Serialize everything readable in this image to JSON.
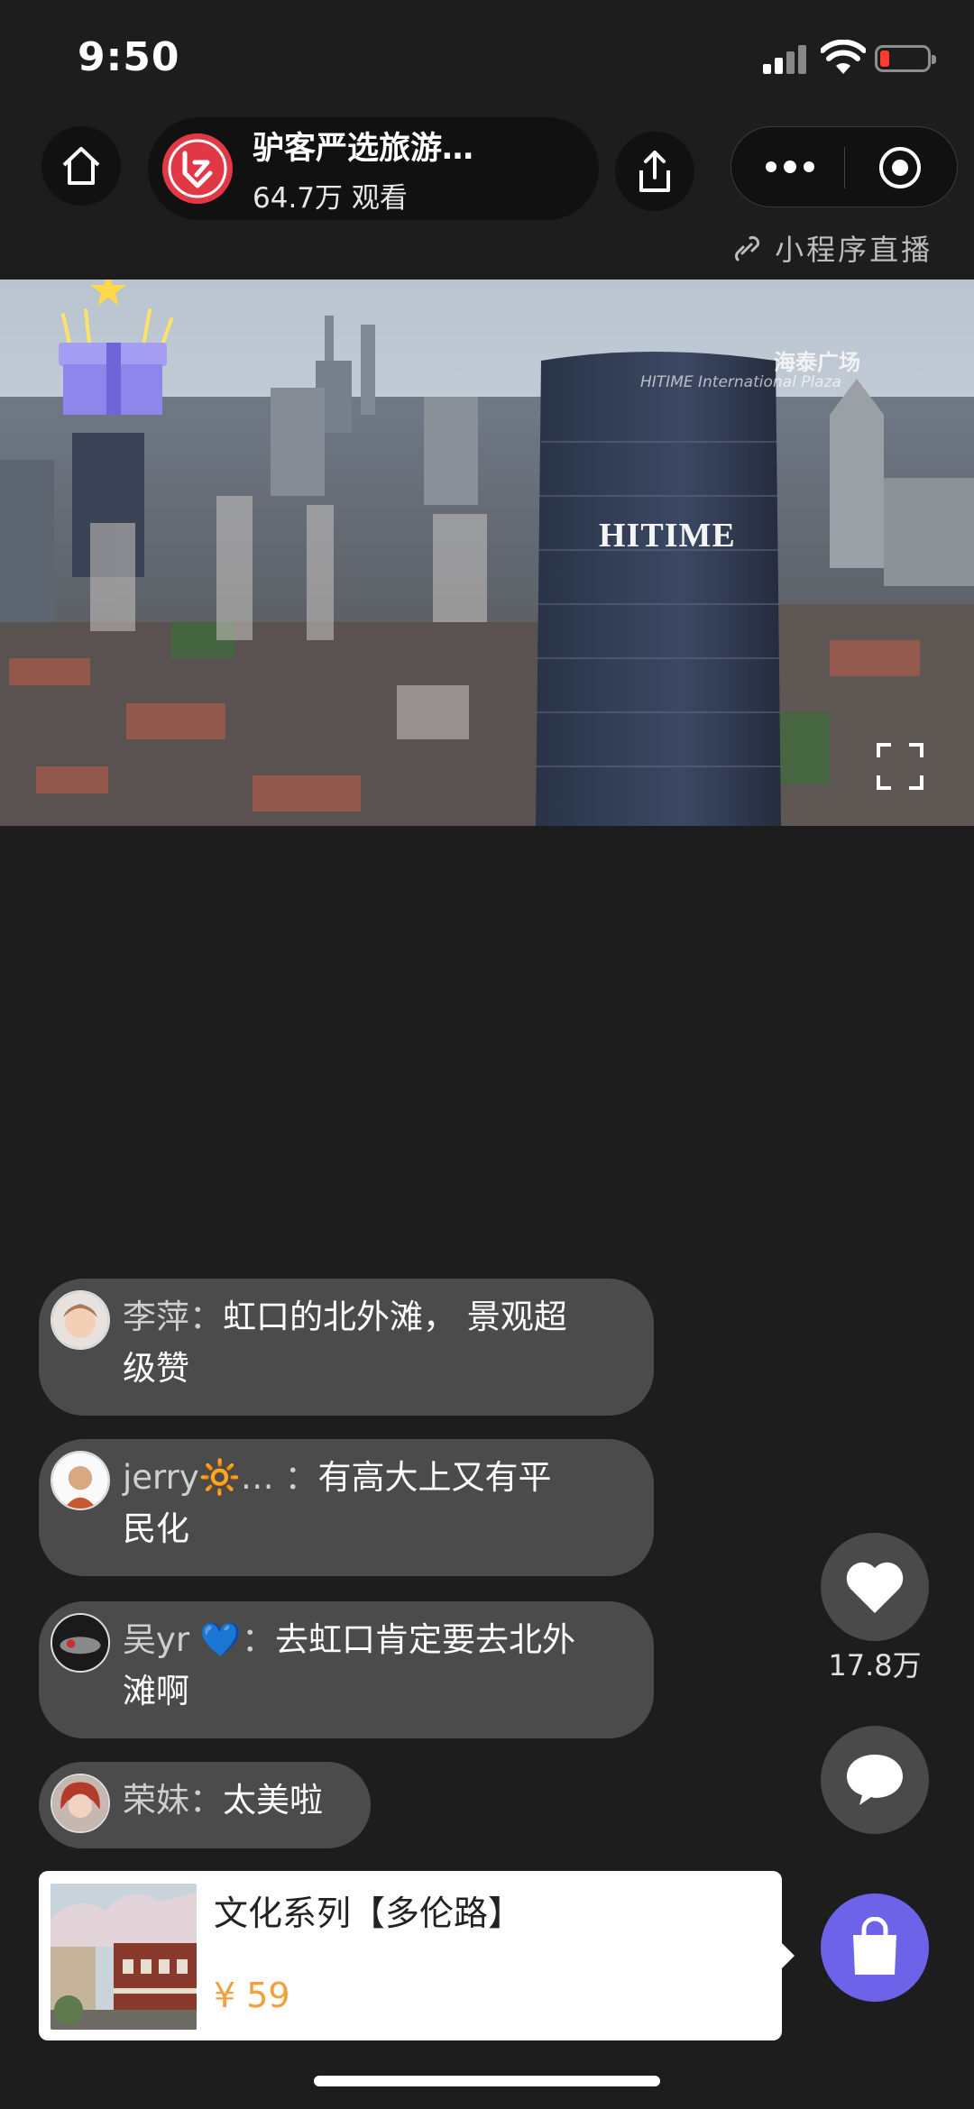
{
  "status_bar": {
    "time": "9:50"
  },
  "header": {
    "channel_name": "驴客严选旅游…",
    "viewers": "64.7万 观看",
    "logo_icon": "lvke-logo-icon",
    "mini_program_live": "小程序直播"
  },
  "video": {
    "watermark_cn": "海泰广场",
    "watermark_en": "HITIME International Plaza",
    "building_sign": "HITIME"
  },
  "comments": [
    {
      "user": "李萍：",
      "text_line1": "虹口的北外滩， 景观超",
      "text_line2": "级赞"
    },
    {
      "user": "jerry🔆… ：",
      "text_line1": "有高大上又有平",
      "text_line2": "民化"
    },
    {
      "user": "吴yr 💙：",
      "text_line1": "去虹口肯定要去北外",
      "text_line2": "滩啊"
    },
    {
      "user": "荣妹：",
      "text_line1": "太美啦"
    }
  ],
  "actions": {
    "like_count": "17.8万",
    "like_icon": "heart-icon",
    "comment_icon": "chat-bubble-icon",
    "cart_icon": "shopping-bag-icon"
  },
  "product": {
    "title": "文化系列【多伦路】",
    "price": "¥ 59"
  },
  "colors": {
    "background": "#1d1d1d",
    "accent_purple": "#6c63e8",
    "price_orange": "#f3a03a",
    "comment_bg": "#4b4b4b"
  }
}
